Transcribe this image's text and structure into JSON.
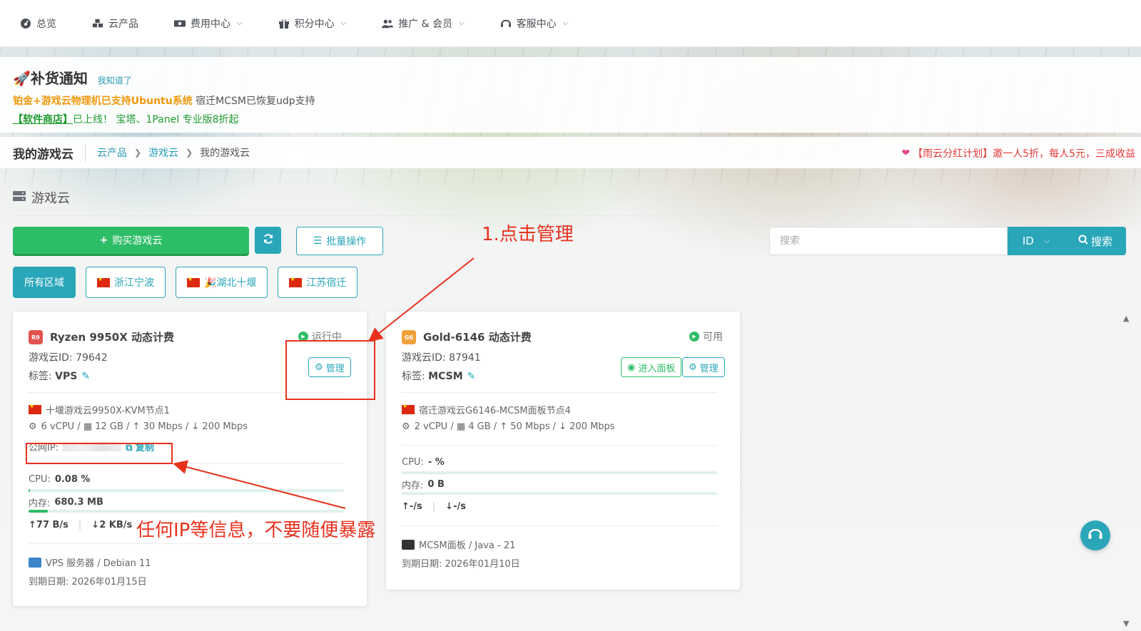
{
  "nav": {
    "items": [
      {
        "label": "总览",
        "icon": "dashboard-icon",
        "has_menu": false
      },
      {
        "label": "云产品",
        "icon": "cubes-icon",
        "has_menu": false
      },
      {
        "label": "费用中心",
        "icon": "money-icon",
        "has_menu": true
      },
      {
        "label": "积分中心",
        "icon": "gift-icon",
        "has_menu": true
      },
      {
        "label": "推广 & 会员",
        "icon": "users-icon",
        "has_menu": true
      },
      {
        "label": "客服中心",
        "icon": "headset-icon",
        "has_menu": true
      }
    ]
  },
  "notice": {
    "title": "🚀补货通知",
    "ack": "我知道了",
    "line1_highlight": "铂金+游戏云物理机已支持Ubuntu系统",
    "line1_rest": " 宿迁MCSM已恢复udp支持",
    "line2_store": "【软件商店】",
    "line2_rest": "已上线！ 宝塔、1Panel 专业版8折起"
  },
  "breadcrumb": {
    "page_title": "我的游戏云",
    "items": [
      "云产品",
      "游戏云",
      "我的游戏云"
    ],
    "promo": "【雨云分红计划】邀一人5折，每人5元，三成收益"
  },
  "section": {
    "title": "游戏云"
  },
  "toolbar": {
    "buy_label": "购买游戏云",
    "batch_label": "批量操作",
    "search_placeholder": "搜索",
    "search_field": "ID",
    "search_button": "搜索"
  },
  "regions": [
    {
      "label": "所有区域",
      "flag": false,
      "active": true
    },
    {
      "label": "浙江宁波",
      "flag": true,
      "active": false
    },
    {
      "label": "🎉湖北十堰",
      "flag": true,
      "active": false
    },
    {
      "label": "江苏宿迁",
      "flag": true,
      "active": false
    }
  ],
  "cards": [
    {
      "badge": "R9",
      "badge_color": "#e2534f",
      "title": "Ryzen 9950X 动态计费",
      "status": "运行中",
      "id_label": "游戏云ID: 79642",
      "tag_label": "标签: ",
      "tag_value": "VPS",
      "buttons": [
        "管理"
      ],
      "node": "十堰游戏云9950X-KVM节点1",
      "specs": "6 vCPU / ▦ 12 GB / ↑ 30 Mbps / ↓ 200 Mbps",
      "ip_label": "公网IP:",
      "copy_label": "复制",
      "cpu_label": "CPU:",
      "cpu_value": "0.08 %",
      "cpu_fraction": 0.0008,
      "mem_label": "内存:",
      "mem_value": "680.3 MB",
      "mem_fraction": 0.06,
      "net_up": "↑77 B/s",
      "net_down": "↓2 KB/s",
      "os": "VPS 服务器 / Debian 11",
      "expire": "到期日期: 2026年01月15日"
    },
    {
      "badge": "G6",
      "badge_color": "#f0a03a",
      "title": "Gold-6146 动态计费",
      "status": "可用",
      "id_label": "游戏云ID: 87941",
      "tag_label": "标签: ",
      "tag_value": "MCSM",
      "buttons": [
        "进入面板",
        "管理"
      ],
      "node": "宿迁游戏云G6146-MCSM面板节点4",
      "specs": "2 vCPU / ▦ 4 GB / ↑ 50 Mbps / ↓ 200 Mbps",
      "cpu_label": "CPU:",
      "cpu_value": "- %",
      "mem_label": "内存:",
      "mem_value": "0 B",
      "net_up": "↑-/s",
      "net_down": "↓-/s",
      "os": "MCSM面板 / Java - 21",
      "expire": "到期日期: 2026年01月10日"
    }
  ],
  "annotations": {
    "step1": "1.点击管理",
    "warning": "任何IP等信息，不要随便暴露"
  }
}
